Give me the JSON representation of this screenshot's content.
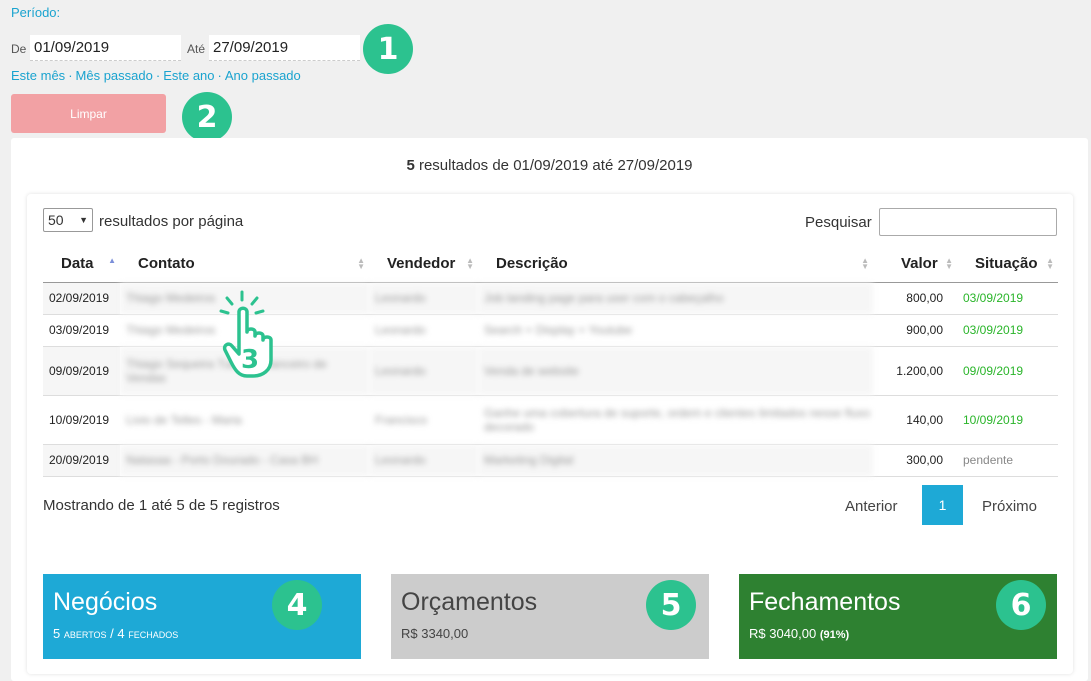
{
  "filter": {
    "periodo_label": "Período:",
    "de_label": "De",
    "de_value": "01/09/2019",
    "ate_label": "Até",
    "ate_value": "27/09/2019",
    "quick_links": [
      "Este mês",
      "Mês passado",
      "Este ano",
      "Ano passado"
    ],
    "clear_button": "Limpar"
  },
  "badges": [
    "1",
    "2",
    "3",
    "4",
    "5",
    "6"
  ],
  "results": {
    "count": "5",
    "summary": " resultados de 01/09/2019 até 27/09/2019"
  },
  "table_controls": {
    "page_length": "50",
    "page_length_suffix": "resultados por página",
    "search_label": "Pesquisar"
  },
  "columns": [
    "Data",
    "Contato",
    "Vendedor",
    "Descrição",
    "Valor",
    "Situação"
  ],
  "rows": [
    {
      "data": "02/09/2019",
      "contato": "Thiago Medeiros",
      "vendedor": "Leonardo",
      "descricao": "Job landing page para user com o cabeçalho",
      "valor": "800,00",
      "situacao": "03/09/2019"
    },
    {
      "data": "03/09/2019",
      "contato": "Thiago Medeiros",
      "vendedor": "Leonardo",
      "descricao": "Search + Display + Youtube",
      "valor": "900,00",
      "situacao": "03/09/2019"
    },
    {
      "data": "09/09/2019",
      "contato": "Thiago Sequeira Tuka - Financeiro de Vendas",
      "vendedor": "Leonardo",
      "descricao": "Venda de website",
      "valor": "1.200,00",
      "situacao": "09/09/2019"
    },
    {
      "data": "10/09/2019",
      "contato": "Livio de Telles - Maria",
      "vendedor": "Francisco",
      "descricao": "Ganhe uma cobertura de suporte, ordem e clientes limitados nesse fluxo decorado",
      "valor": "140,00",
      "situacao": "10/09/2019"
    },
    {
      "data": "20/09/2019",
      "contato": "Natasaa - Porto Dourado - Casa BH",
      "vendedor": "Leonardo",
      "descricao": "Marketing Digital",
      "valor": "300,00",
      "situacao": "pendente"
    }
  ],
  "pagination": {
    "showing": "Mostrando de 1 até 5 de 5 registros",
    "prev": "Anterior",
    "page": "1",
    "next": "Próximo"
  },
  "tiles": {
    "negocios": {
      "title": "Negócios",
      "sub": "5 abertos / 4 fechados"
    },
    "orcamentos": {
      "title": "Orçamentos",
      "sub": "R$ 3340,00"
    },
    "fechamentos": {
      "title": "Fechamentos",
      "sub_value": "R$ 3040,00",
      "sub_pct": "(91%)"
    }
  },
  "colors": {
    "accent_blue": "#1ea9d6",
    "badge_green": "#2cc28f",
    "clear_red": "#f2a1a4",
    "closing_green": "#2e8131",
    "status_green": "#2ab52a"
  }
}
